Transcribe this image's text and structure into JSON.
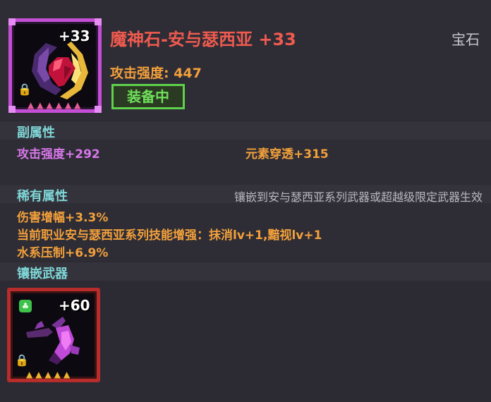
{
  "item": {
    "name": "魔神石-安与瑟西亚 +33",
    "category": "宝石",
    "level_badge": "+33",
    "main_stat": "攻击强度: 447",
    "equipped_label": "装备中",
    "star_count": 6
  },
  "secondary": {
    "title": "副属性",
    "attrs": [
      "攻击强度+292",
      "元素穿透+315"
    ]
  },
  "rare": {
    "title": "稀有属性",
    "note": "镶嵌到安与瑟西亚系列武器或超越级限定武器生效",
    "attrs": [
      "伤害增幅+3.3%",
      "当前职业安与瑟西亚系列技能增强：抹消lv+1,黯视lv+1",
      "水系压制+6.9%"
    ]
  },
  "socket": {
    "title": "镶嵌武器",
    "weapon_level_badge": "+60",
    "star_count": 5
  },
  "icons": {
    "lock": "lock-icon",
    "gem": "gem-icon",
    "weapon": "weapon-icon",
    "clover": "clover-icon",
    "star": "star-icon"
  },
  "colors": {
    "title": "#f05a4f",
    "stat": "#f3a03b",
    "equipped": "#6fe05a",
    "section": "#7fd6d6",
    "purple_attr": "#d877ea",
    "item_frame": "#c44fd6",
    "weapon_frame": "#b82c2c"
  }
}
